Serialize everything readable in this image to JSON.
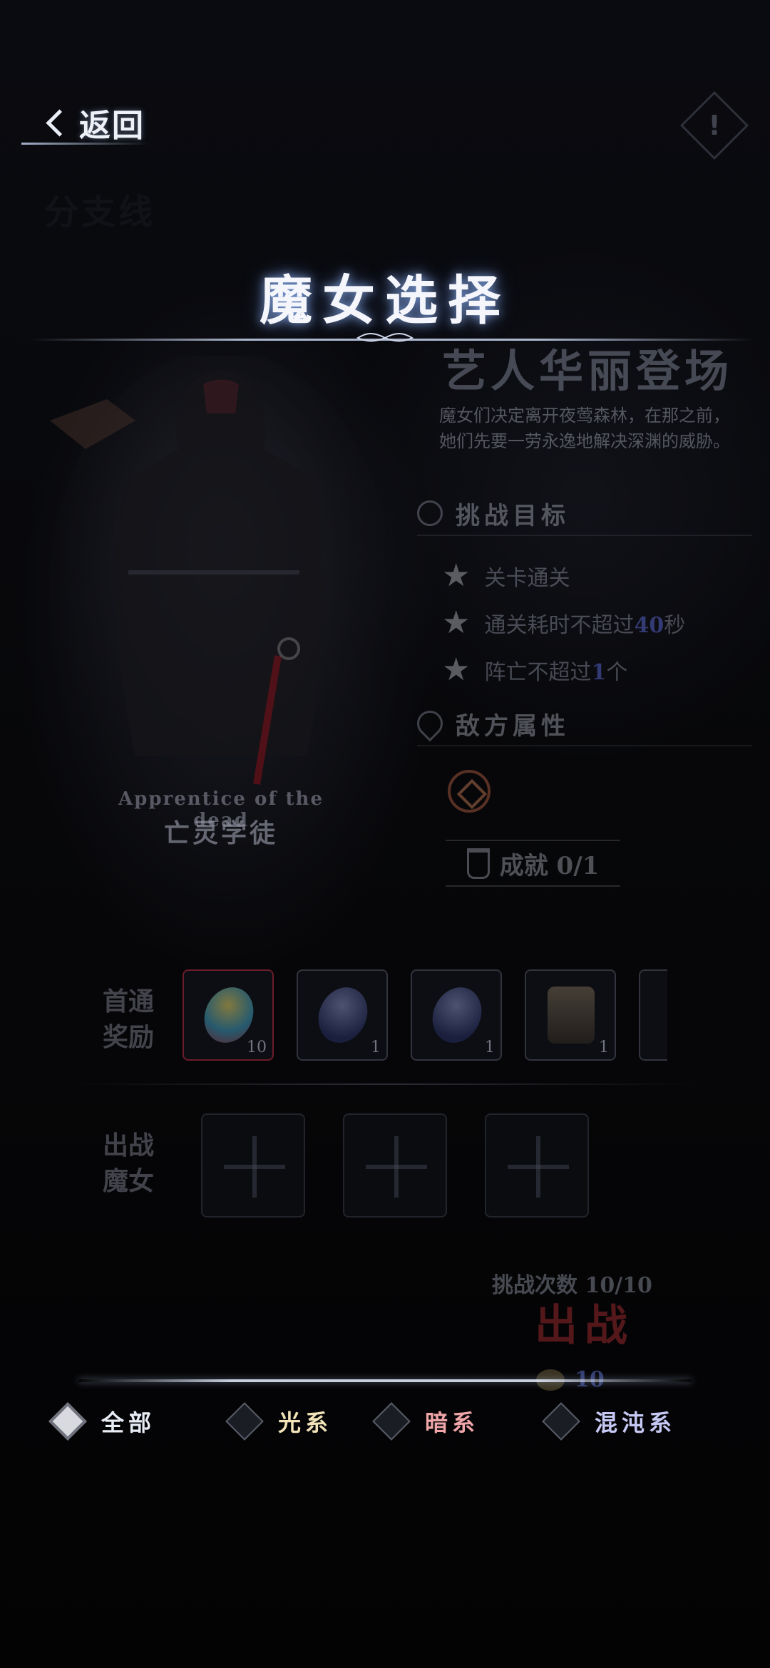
{
  "header": {
    "back_label": "返回",
    "alert_symbol": "!",
    "faint_label": "分支线"
  },
  "title": "魔女选择",
  "stage": {
    "name": "艺人华丽登场",
    "description": "魔女们决定离开夜莺森林，在那之前，她们先要一劳永逸地解决深渊的威胁。",
    "objectives_heading": "挑战目标",
    "objectives": [
      {
        "text": "关卡通关",
        "highlight": "",
        "suffix": ""
      },
      {
        "text": "通关耗时不超过",
        "highlight": "40",
        "suffix": "秒"
      },
      {
        "text": "阵亡不超过",
        "highlight": "1",
        "suffix": "个"
      }
    ],
    "enemy_heading": "敌方属性",
    "achievement": "成就 0/1"
  },
  "character": {
    "name_en": "Apprentice of the dead",
    "name": "亡灵学徒"
  },
  "rewards": {
    "label": "首通奖励",
    "items": [
      {
        "icon": "rainbow-gem-icon",
        "count": "10"
      },
      {
        "icon": "dark-crystal-icon",
        "count": "1"
      },
      {
        "icon": "dark-crystal-icon",
        "count": "1"
      },
      {
        "icon": "chest-icon",
        "count": "1"
      }
    ]
  },
  "deploy": {
    "label": "出战魔女"
  },
  "challenge": {
    "tries": "挑战次数 10/10",
    "fight_label": "出战",
    "cost": "10"
  },
  "filters": [
    {
      "label": "全部",
      "color": "#e8ecf5",
      "active": true
    },
    {
      "label": "光系",
      "color": "#f2e4b8",
      "active": false
    },
    {
      "label": "暗系",
      "color": "#f0a6a8",
      "active": false
    },
    {
      "label": "混沌系",
      "color": "#c7c9f5",
      "active": false
    }
  ]
}
